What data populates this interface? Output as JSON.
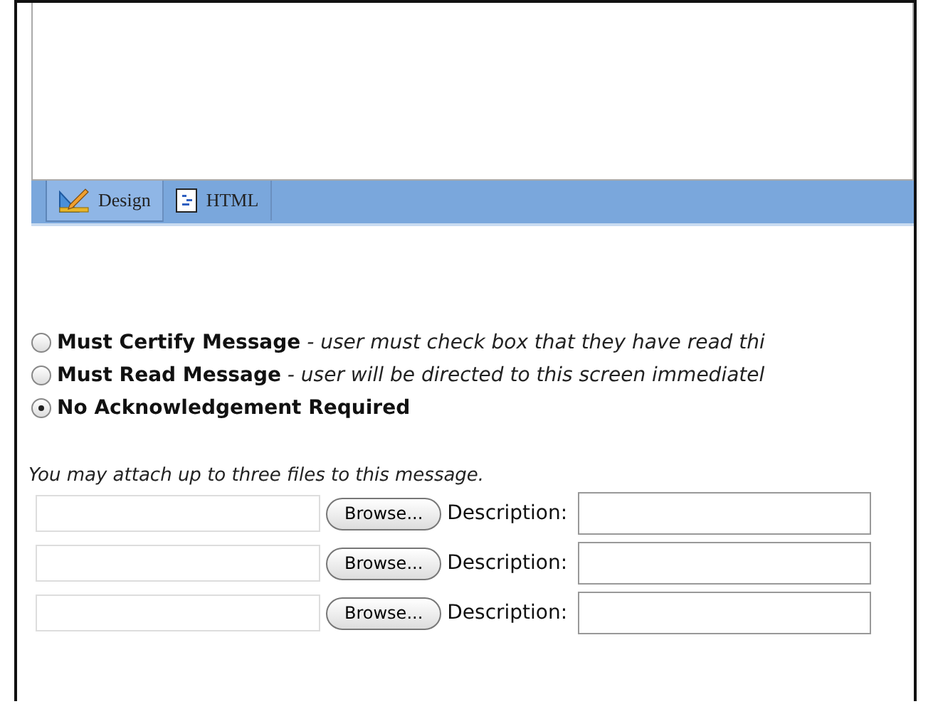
{
  "editor_tabs": [
    {
      "label": "Design",
      "selected": true
    },
    {
      "label": "HTML",
      "selected": false
    }
  ],
  "acknowledgement_options": [
    {
      "label": "Must Certify Message",
      "description": " - user must check box that they have read thi",
      "selected": false
    },
    {
      "label": "Must Read Message",
      "description": " - user will be directed to this screen immediatel",
      "selected": false
    },
    {
      "label": "No Acknowledgement Required",
      "selected": true
    }
  ],
  "attachments": {
    "note": "You may attach up to three files to this message.",
    "rows": [
      {
        "button": "Browse...",
        "description_label": "Description:"
      },
      {
        "button": "Browse...",
        "description_label": "Description:"
      },
      {
        "button": "Browse...",
        "description_label": "Description:"
      }
    ]
  }
}
